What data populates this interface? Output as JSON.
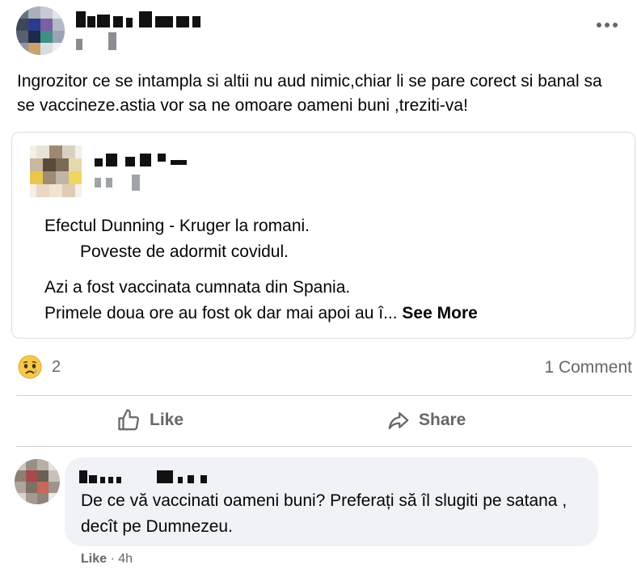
{
  "post": {
    "more_icon": "more-horizontal-icon",
    "text": "Ingrozitor ce se intampla si altii nu aud nimic,chiar li se pare corect si banal sa se vaccineze.astia vor sa ne omoare oameni buni ,treziti-va!"
  },
  "shared": {
    "line1": "Efectul Dunning - Kruger la romani.",
    "line2": "Poveste de adormit covidul.",
    "line3": "Azi a fost vaccinata cumnata din Spania.",
    "line4": "Primele doua ore au fost ok dar mai apoi au î...",
    "see_more": "See More"
  },
  "stats": {
    "reaction_icon": "sad-reaction-icon",
    "reaction_count": "2",
    "comment_count": "1 Comment"
  },
  "actions": {
    "like_label": "Like",
    "share_label": "Share"
  },
  "comment": {
    "text": "De ce vă vaccinati oameni buni? Preferați să îl slugiti pe satana , decît pe Dumnezeu.",
    "like_label": "Like",
    "separator": "·",
    "time": "4h"
  },
  "colors": {
    "text_primary": "#050505",
    "text_secondary": "#65676b",
    "divider": "#ced0d4",
    "comment_bg": "#f0f2f5"
  }
}
